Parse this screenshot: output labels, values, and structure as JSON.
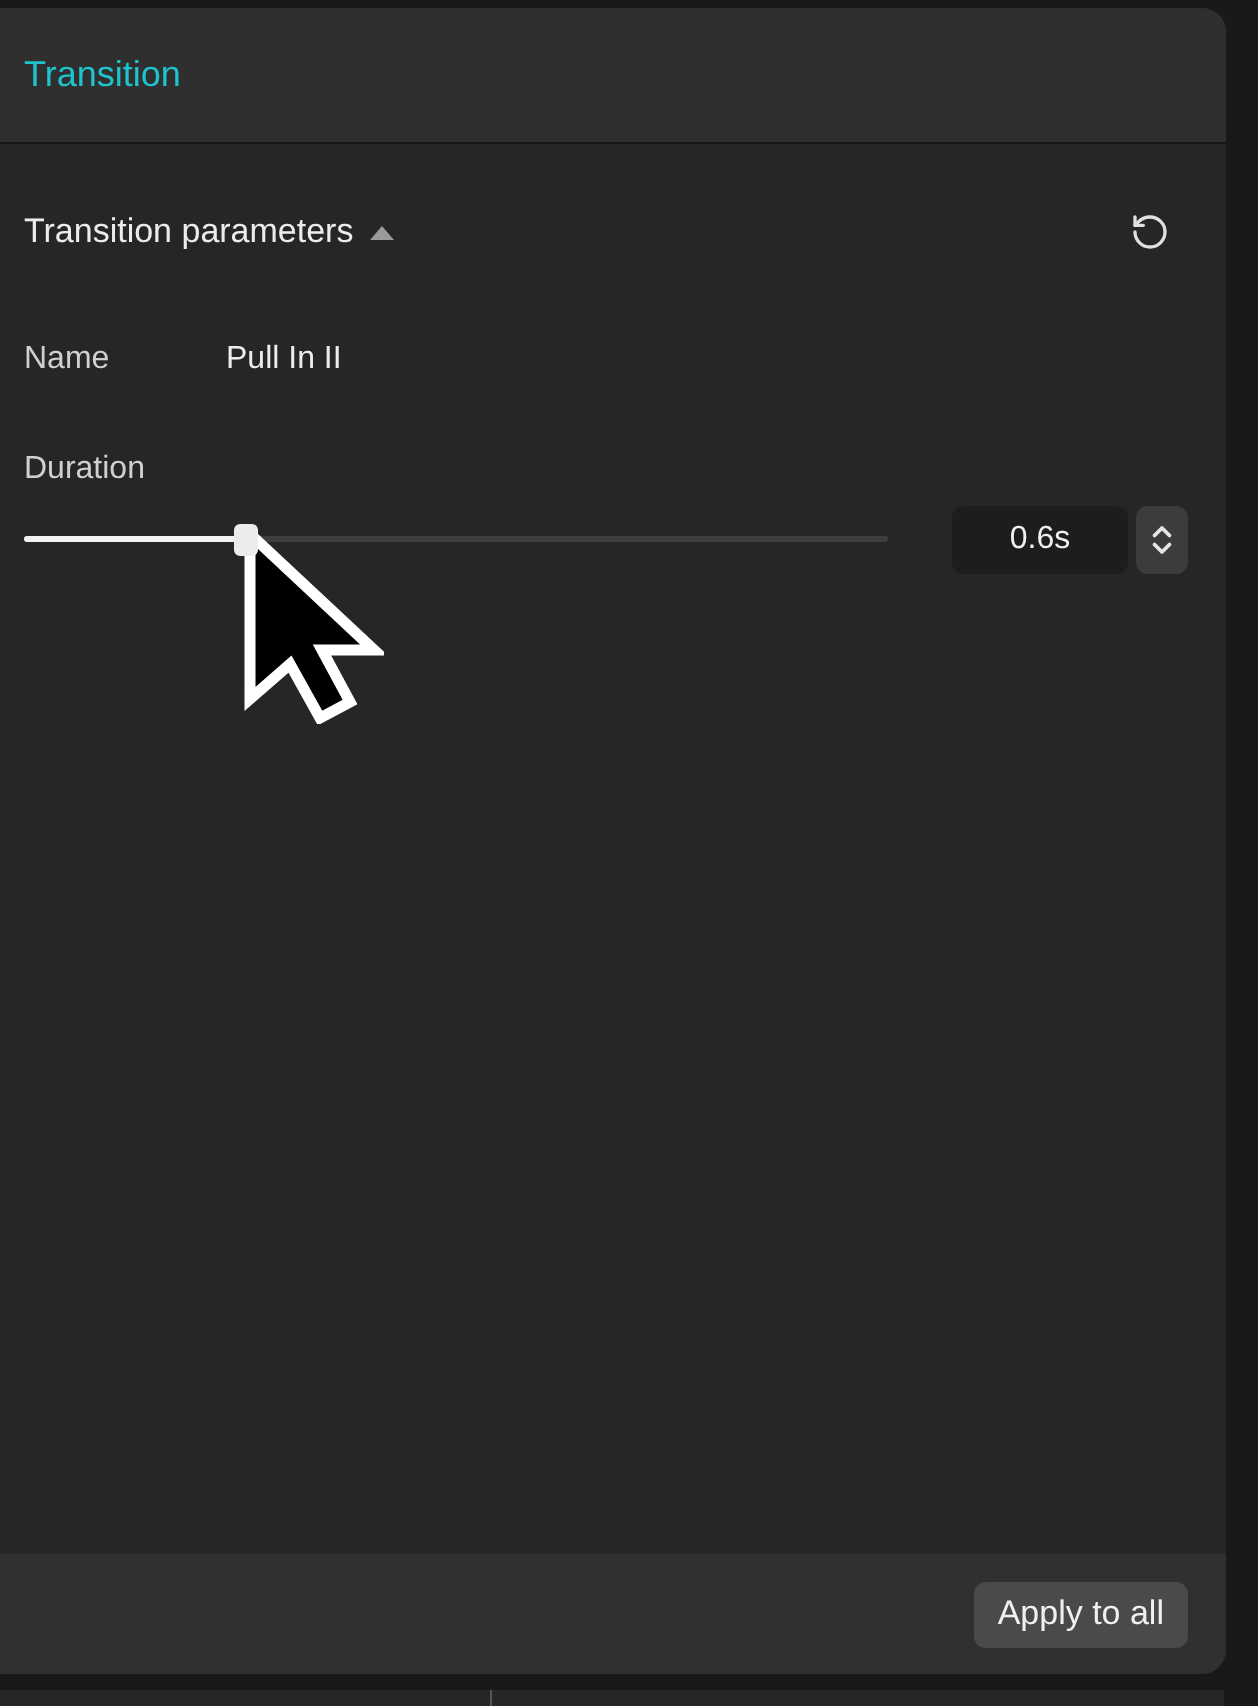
{
  "panel": {
    "title": "Transition"
  },
  "section": {
    "title": "Transition parameters",
    "expanded": true
  },
  "fields": [
    {
      "kind": "text",
      "label": "Name",
      "value": "Pull In II"
    },
    {
      "kind": "slider",
      "label": "Duration",
      "level": 0.257,
      "reading": "0.6s"
    }
  ],
  "footer": {
    "button": "Apply to all"
  }
}
